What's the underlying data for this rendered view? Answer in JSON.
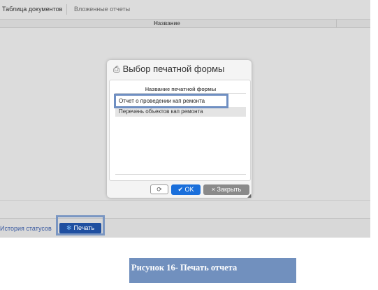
{
  "tabs": [
    "Таблица документов",
    "Вложенные отчеты"
  ],
  "table": {
    "column_name": "Название"
  },
  "footer": {
    "history_link": "История статусов",
    "print_button": "Печать"
  },
  "dialog": {
    "title": "Выбор печатной формы",
    "list_header": "Название печатной формы",
    "rows": [
      "Отчет о проведении кап ремонта",
      "Перечень объектов кап ремонта"
    ],
    "ok_button": "OK",
    "close_button": "Закрыть"
  },
  "caption": "Рисунок 16- Печать отчета",
  "icons": {
    "printer": "printer-icon",
    "refresh": "refresh-icon",
    "check": "check-icon",
    "close": "close-icon"
  },
  "colors": {
    "primary_button": "#1a6fdb",
    "print_button": "#1f4fa0",
    "close_button": "#8a8a8a",
    "highlight_frame": "#6f8fc2",
    "caption_background": "#7190be"
  }
}
